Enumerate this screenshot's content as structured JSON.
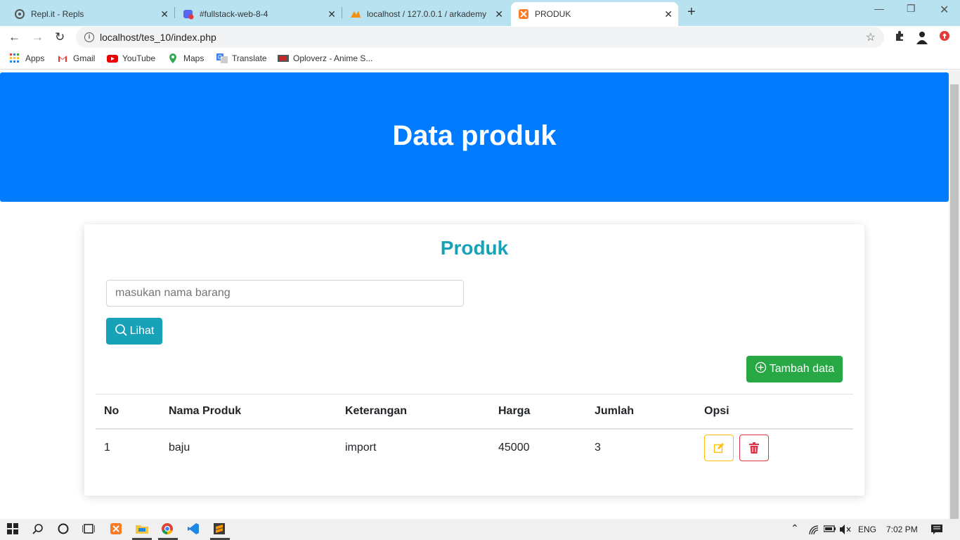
{
  "browser": {
    "tabs": [
      {
        "title": "Repl.it - Repls",
        "icon": "replit-icon"
      },
      {
        "title": "#fullstack-web-8-4",
        "icon": "discord-icon"
      },
      {
        "title": "localhost / 127.0.0.1 / arkademy",
        "icon": "phpmyadmin-icon"
      },
      {
        "title": "PRODUK",
        "icon": "xampp-icon",
        "active": true
      }
    ],
    "url": "localhost/tes_10/index.php",
    "bookmarks": [
      "Apps",
      "Gmail",
      "YouTube",
      "Maps",
      "Translate",
      "Oploverz - Anime S..."
    ]
  },
  "page": {
    "jumbotron_title": "Data produk",
    "card_title": "Produk",
    "search_placeholder": "masukan nama barang",
    "search_button": "Lihat",
    "add_button": "Tambah data",
    "table": {
      "headers": [
        "No",
        "Nama Produk",
        "Keterangan",
        "Harga",
        "Jumlah",
        "Opsi"
      ],
      "rows": [
        {
          "no": "1",
          "nama": "baju",
          "keterangan": "import",
          "harga": "45000",
          "jumlah": "3"
        }
      ]
    }
  },
  "taskbar": {
    "language": "ENG",
    "time": "7:02 PM"
  },
  "colors": {
    "primary": "#007bff",
    "info": "#17a2b8",
    "success": "#28a745",
    "warning": "#ffc107",
    "danger": "#dc3545"
  }
}
